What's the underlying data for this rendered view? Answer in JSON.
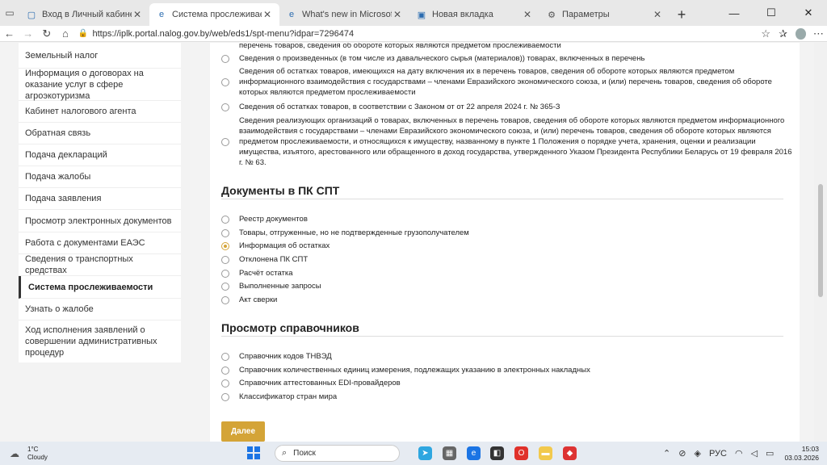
{
  "browser": {
    "tabs": [
      {
        "label": "Вход в Личный кабинет",
        "icon": "page-icon",
        "active": false
      },
      {
        "label": "Система прослеживаемости - ЛК",
        "icon": "edge-icon",
        "active": true
      },
      {
        "label": "What's new in Microsoft Edge",
        "icon": "edge-icon",
        "active": false
      },
      {
        "label": "Новая вкладка",
        "icon": "newtab-icon",
        "active": false
      },
      {
        "label": "Параметры",
        "icon": "gear-icon",
        "active": false
      }
    ],
    "url": "https://iplk.portal.nalog.gov.by/web/eds1/spt-menu?idpar=7296474"
  },
  "sidebar": {
    "items": [
      {
        "label": "Земельный налог",
        "active": false
      },
      {
        "label": "Информация о договорах на оказание услуг в сфере агроэкотуризма",
        "active": false
      },
      {
        "label": "Кабинет налогового агента",
        "active": false
      },
      {
        "label": "Обратная связь",
        "active": false
      },
      {
        "label": "Подача деклараций",
        "active": false
      },
      {
        "label": "Подача жалобы",
        "active": false
      },
      {
        "label": "Подача заявления",
        "active": false
      },
      {
        "label": "Просмотр электронных документов",
        "active": false
      },
      {
        "label": "Работа с документами ЕАЭС",
        "active": false
      },
      {
        "label": "Сведения о транспортных средствах",
        "active": false
      },
      {
        "label": "Система прослеживаемости",
        "active": true
      },
      {
        "label": "Узнать о жалобе",
        "active": false
      },
      {
        "label": "Ход исполнения заявлений о совершении административных процедур",
        "active": false
      }
    ]
  },
  "main": {
    "top_options": [
      "перечень товаров, сведения об обороте которых являются предметом прослеживаемости",
      "Сведения о произведенных (в том числе из давальческого сырья (материалов)) товарах, включенных в перечень",
      "Сведения об остатках товаров, имеющихся на дату включения их в перечень товаров, сведения об обороте которых являются предметом информационного взаимодействия с государствами – членами Евразийского экономического союза, и (или) перечень товаров, сведения об обороте которых являются предметом прослеживаемости",
      "Сведения об остатках товаров, в соответствии с Законом от от 22 апреля 2024 г. № 365-З",
      "Сведения реализующих организаций о товарах, включенных в перечень товаров, сведения об обороте которых являются предметом информационного взаимодействия с государствами – членами Евразийского экономического союза, и (или) перечень товаров, сведения об обороте которых являются предметом прослеживаемости, и относящихся к имуществу, названному в пункте 1 Положения о порядке учета, хранения, оценки и реализации имущества, изъятого, арестованного или обращенного в доход государства, утвержденного Указом Президента Республики Беларусь от 19 февраля 2016 г. № 63."
    ],
    "section1_title": "Документы в ПК СПТ",
    "section1_options": [
      {
        "label": "Реестр документов",
        "checked": false
      },
      {
        "label": "Товары, отгруженные, но не подтвержденные грузополучателем",
        "checked": false
      },
      {
        "label": "Информация об остатках",
        "checked": true
      },
      {
        "label": "Отклонена ПК СПТ",
        "checked": false
      },
      {
        "label": "Расчёт остатка",
        "checked": false
      },
      {
        "label": "Выполненные запросы",
        "checked": false
      },
      {
        "label": "Акт сверки",
        "checked": false
      }
    ],
    "section2_title": "Просмотр справочников",
    "section2_options": [
      {
        "label": "Справочник кодов ТНВЭД",
        "checked": false
      },
      {
        "label": "Справочник количественных единиц измерения, подлежащих указанию в электронных накладных",
        "checked": false
      },
      {
        "label": "Справочник аттестованных EDI-провайдеров",
        "checked": false
      },
      {
        "label": "Классификатор стран мира",
        "checked": false
      }
    ],
    "next_button": "Далее"
  },
  "taskbar": {
    "weather_temp": "1°C",
    "weather_desc": "Cloudy",
    "weather_badge": "1",
    "search_placeholder": "Поиск",
    "lang": "РУС",
    "time": "15:03",
    "date": "03.03.2026"
  },
  "colors": {
    "accent": "#d4a437",
    "sidebar_bg": "#ffffff",
    "page_bg": "#f3f3f3"
  }
}
